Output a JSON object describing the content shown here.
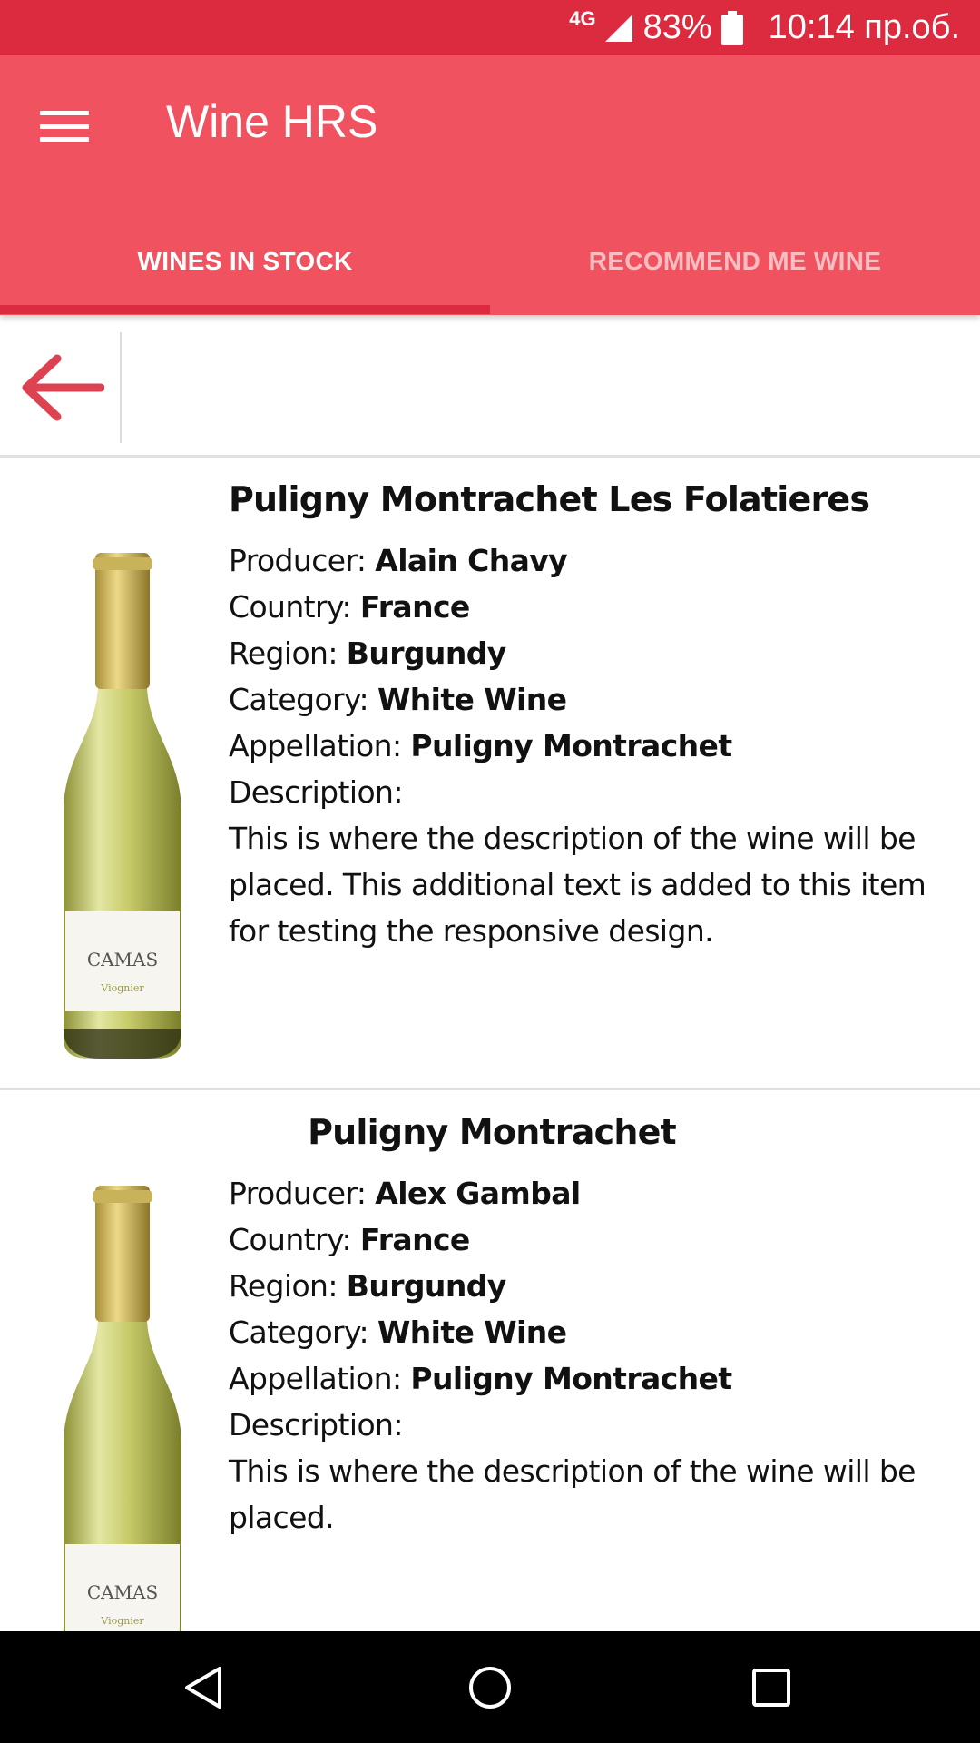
{
  "status_bar": {
    "network": "4G",
    "battery_percent": "83%",
    "time": "10:14 пр.об."
  },
  "app_bar": {
    "title": "Wine HRS",
    "menu_icon": "hamburger-menu-icon"
  },
  "tabs": [
    {
      "label": "WINES IN STOCK",
      "active": true
    },
    {
      "label": "RECOMMEND ME WINE",
      "active": false
    }
  ],
  "back_button": {
    "icon": "arrow-left-icon",
    "color": "#dc4250"
  },
  "wines": [
    {
      "title": "Puligny Montrachet Les Folatieres",
      "producer_label": "Producer:",
      "producer": "Alain Chavy",
      "country_label": "Country:",
      "country": "France",
      "region_label": "Region:",
      "region": "Burgundy",
      "category_label": "Category:",
      "category": "White Wine",
      "appellation_label": "Appellation:",
      "appellation": "Puligny Montrachet",
      "description_label": "Description:",
      "description": "This is where the description of the wine will be placed. This additional text is added to this item for testing the responsive design.",
      "bottle_label": {
        "brand": "CAMAS",
        "varietal": "Viognier"
      }
    },
    {
      "title": "Puligny Montrachet",
      "producer_label": "Producer:",
      "producer": "Alex Gambal",
      "country_label": "Country:",
      "country": "France",
      "region_label": "Region:",
      "region": "Burgundy",
      "category_label": "Category:",
      "category": "White Wine",
      "appellation_label": "Appellation:",
      "appellation": "Puligny Montrachet",
      "description_label": "Description:",
      "description": "This is where the description of the wine will be placed.",
      "bottle_label": {
        "brand": "CAMAS",
        "varietal": "Viognier"
      }
    }
  ],
  "nav_bar": {
    "back": "nav-back-icon",
    "home": "nav-home-icon",
    "recents": "nav-recents-icon"
  },
  "colors": {
    "status_bar": "#dc2a3e",
    "app_bar": "#f0535f",
    "tab_indicator": "#dc2a3e",
    "accent": "#dc4250"
  }
}
